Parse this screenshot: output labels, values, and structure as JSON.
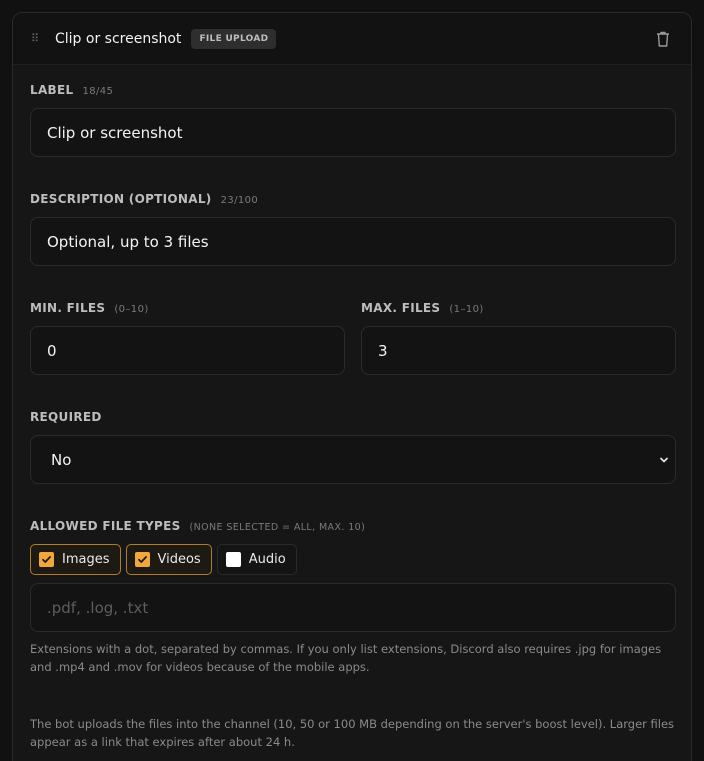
{
  "header": {
    "drag_icon": "⠿",
    "title": "Clip or screenshot",
    "badge": "FILE UPLOAD"
  },
  "label_field": {
    "label": "LABEL",
    "counter": "18/45",
    "value": "Clip or screenshot"
  },
  "description_field": {
    "label": "DESCRIPTION (OPTIONAL)",
    "counter": "23/100",
    "value": "Optional, up to 3 files"
  },
  "min_files": {
    "label": "MIN. FILES",
    "hint": "(0–10)",
    "value": "0"
  },
  "max_files": {
    "label": "MAX. FILES",
    "hint": "(1–10)",
    "value": "3"
  },
  "required": {
    "label": "REQUIRED",
    "value": "No"
  },
  "file_types": {
    "label": "ALLOWED FILE TYPES",
    "hint": "(NONE SELECTED = ALL, MAX. 10)",
    "options": [
      {
        "label": "Images",
        "checked": true
      },
      {
        "label": "Videos",
        "checked": true
      },
      {
        "label": "Audio",
        "checked": false
      }
    ],
    "extensions_placeholder": ".pdf, .log, .txt",
    "help": "Extensions with a dot, separated by commas. If you only list extensions, Discord also requires .jpg for images and .mp4 and .mov for videos because of the mobile apps."
  },
  "footer_note": "The bot uploads the files into the channel (10, 50 or 100 MB depending on the server's boost level). Larger files appear as a link that expires after about 24 h.",
  "colors": {
    "accent": "#f0a83a",
    "chip_border_active": "#b07d2c",
    "background": "#111111"
  }
}
